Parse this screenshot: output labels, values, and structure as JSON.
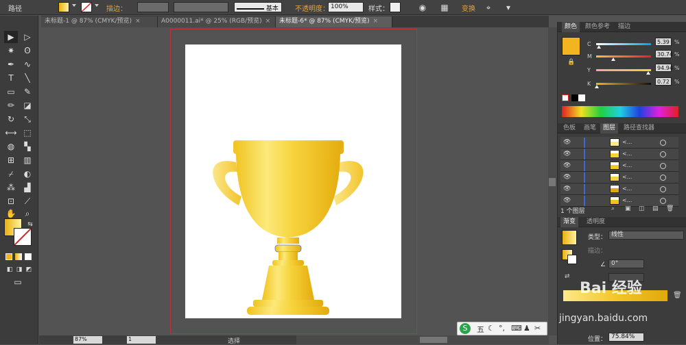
{
  "control_bar": {
    "object_type": "路径",
    "stroke_label": "描边：",
    "stroke_style": "基本",
    "opacity_label": "不透明度：",
    "opacity_value": "100%",
    "style_label": "样式：",
    "transform_label": "变换"
  },
  "tabs": [
    {
      "label": "未标题-1 @ 87% (CMYK/预览)",
      "active": false
    },
    {
      "label": "A0000011.ai* @ 25% (RGB/预览)",
      "active": false
    },
    {
      "label": "未标题-6* @ 87% (CMYK/预览)",
      "active": true
    }
  ],
  "color_panel": {
    "tabs": [
      "颜色",
      "颜色参考",
      "描边"
    ],
    "channels": [
      {
        "label": "C",
        "value": "5.39",
        "unit": "%",
        "fraction": 0.054
      },
      {
        "label": "M",
        "value": "30.74",
        "unit": "%",
        "fraction": 0.307
      },
      {
        "label": "Y",
        "value": "94.94",
        "unit": "%",
        "fraction": 0.949
      },
      {
        "label": "K",
        "value": "0.72",
        "unit": "%",
        "fraction": 0.007
      }
    ],
    "fill_color": "#f3b51f"
  },
  "layers_panel": {
    "tabs": [
      "色板",
      "画笔",
      "图层",
      "路径查找器"
    ],
    "rows": [
      "<...",
      "<...",
      "<...",
      "<...",
      "<...",
      "<..."
    ],
    "count_label": "1 个图层"
  },
  "gradient_panel": {
    "tabs": [
      "渐变",
      "透明度"
    ],
    "type_label": "类型：",
    "type_value": "线性",
    "stroke_label": "描边：",
    "angle_value": "0°",
    "location_label": "位置：",
    "location_value": "75.84%"
  },
  "status": {
    "zoom": "87%",
    "page": "1",
    "mode": "选择"
  },
  "ime": {
    "label": "五"
  },
  "watermark": {
    "text": "Bai 经验",
    "url": "jingyan.baidu.com"
  },
  "colors": {
    "gold_light": "#fbe98a",
    "gold": "#f3c629",
    "gold_dark": "#e0a90d",
    "bleed": "#c0303a"
  }
}
